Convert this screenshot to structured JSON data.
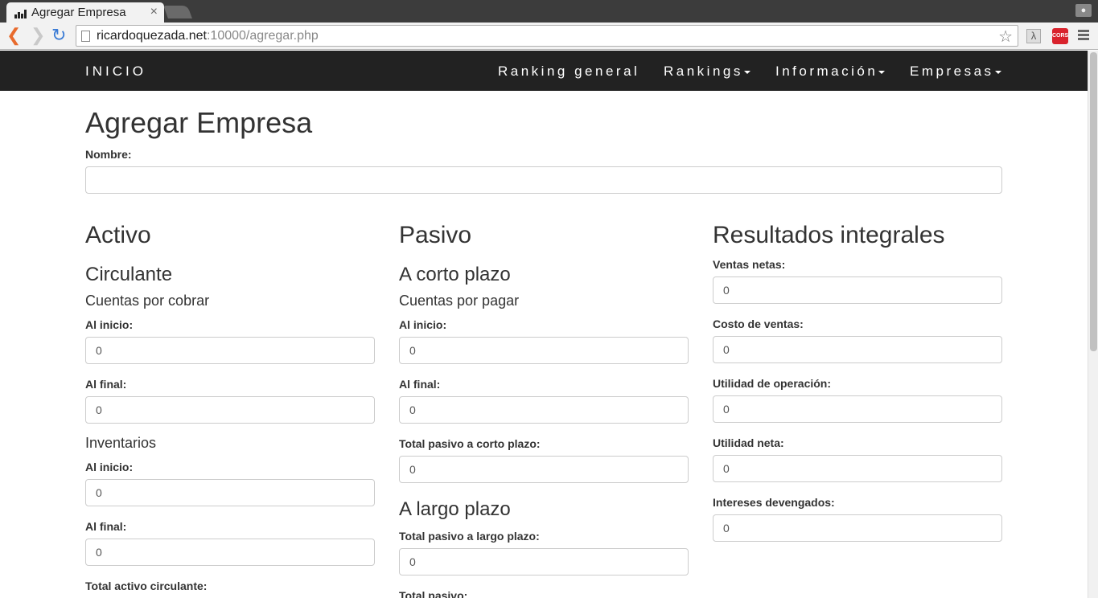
{
  "browser": {
    "tab_title": "Agregar Empresa",
    "tab_close": "×",
    "url_host": "ricardoquezada.net",
    "url_rest": ":10000/agregar.php",
    "ext_lambda": "λ",
    "ext_cors": "CORS"
  },
  "navbar": {
    "brand": "INICIO",
    "items": [
      {
        "label": "Ranking general"
      },
      {
        "label": "Rankings"
      },
      {
        "label": "Información"
      },
      {
        "label": "Empresas"
      }
    ]
  },
  "page": {
    "title": "Agregar Empresa",
    "nombre_label": "Nombre:",
    "nombre_value": ""
  },
  "activo": {
    "heading": "Activo",
    "circulante": "Circulante",
    "cuentas_cobrar": "Cuentas por cobrar",
    "cc_inicio_label": "Al inicio:",
    "cc_inicio_value": "0",
    "cc_final_label": "Al final:",
    "cc_final_value": "0",
    "inventarios": "Inventarios",
    "inv_inicio_label": "Al inicio:",
    "inv_inicio_value": "0",
    "inv_final_label": "Al final:",
    "inv_final_value": "0",
    "total_label": "Total activo circulante:"
  },
  "pasivo": {
    "heading": "Pasivo",
    "corto_plazo": "A corto plazo",
    "cuentas_pagar": "Cuentas por pagar",
    "cp_inicio_label": "Al inicio:",
    "cp_inicio_value": "0",
    "cp_final_label": "Al final:",
    "cp_final_value": "0",
    "total_corto_label": "Total pasivo a corto plazo:",
    "total_corto_value": "0",
    "largo_plazo": "A largo plazo",
    "total_largo_label": "Total pasivo a largo plazo:",
    "total_largo_value": "0",
    "total_label": "Total pasivo:"
  },
  "resultados": {
    "heading": "Resultados integrales",
    "ventas_label": "Ventas netas:",
    "ventas_value": "0",
    "costo_label": "Costo de ventas:",
    "costo_value": "0",
    "util_op_label": "Utilidad de operación:",
    "util_op_value": "0",
    "util_neta_label": "Utilidad neta:",
    "util_neta_value": "0",
    "intereses_label": "Intereses devengados:",
    "intereses_value": "0"
  },
  "colors": {
    "navbar_bg": "#222222",
    "back_arrow": "#e86b2d",
    "reload": "#3a7bd5",
    "cors_badge": "#d9232d"
  }
}
